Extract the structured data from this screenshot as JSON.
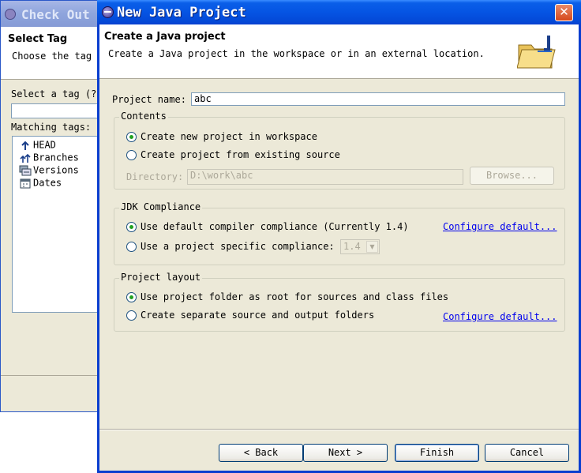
{
  "background_dialog": {
    "title": "Check Out",
    "header": "Select Tag",
    "description": "Choose the tag t",
    "select_tag_label": "Select a tag (?",
    "matching_tags_label": "Matching tags:",
    "tree": [
      {
        "label": "HEAD",
        "icon": "head-branch-icon"
      },
      {
        "label": "Branches",
        "icon": "branches-icon"
      },
      {
        "label": "Versions",
        "icon": "versions-icon"
      },
      {
        "label": "Dates",
        "icon": "dates-icon"
      }
    ]
  },
  "dialog": {
    "title": "New Java Project",
    "close_label": "✕",
    "header_title": "Create a Java project",
    "header_description": "Create a Java project in the workspace or in an external location.",
    "project_name_label": "Project name:",
    "project_name_value": "abc",
    "contents": {
      "label": "Contents",
      "option_new": "Create new project in workspace",
      "option_existing": "Create project from existing source",
      "selected": "new",
      "directory_label": "Directory:",
      "directory_value": "D:\\work\\abc",
      "browse_label": "Browse..."
    },
    "jdk": {
      "label": "JDK Compliance",
      "option_default": "Use default compiler compliance (Currently 1.4)",
      "option_specific": "Use a project specific compliance:",
      "selected": "default",
      "compliance_value": "1.4",
      "configure_link": "Configure default..."
    },
    "layout": {
      "label": "Project layout",
      "option_root": "Use project folder as root for sources and class files",
      "option_separate": "Create separate source and output folders",
      "selected": "root",
      "configure_link": "Configure default..."
    },
    "buttons": {
      "back": "< Back",
      "next": "Next >",
      "finish": "Finish",
      "cancel": "Cancel"
    }
  }
}
